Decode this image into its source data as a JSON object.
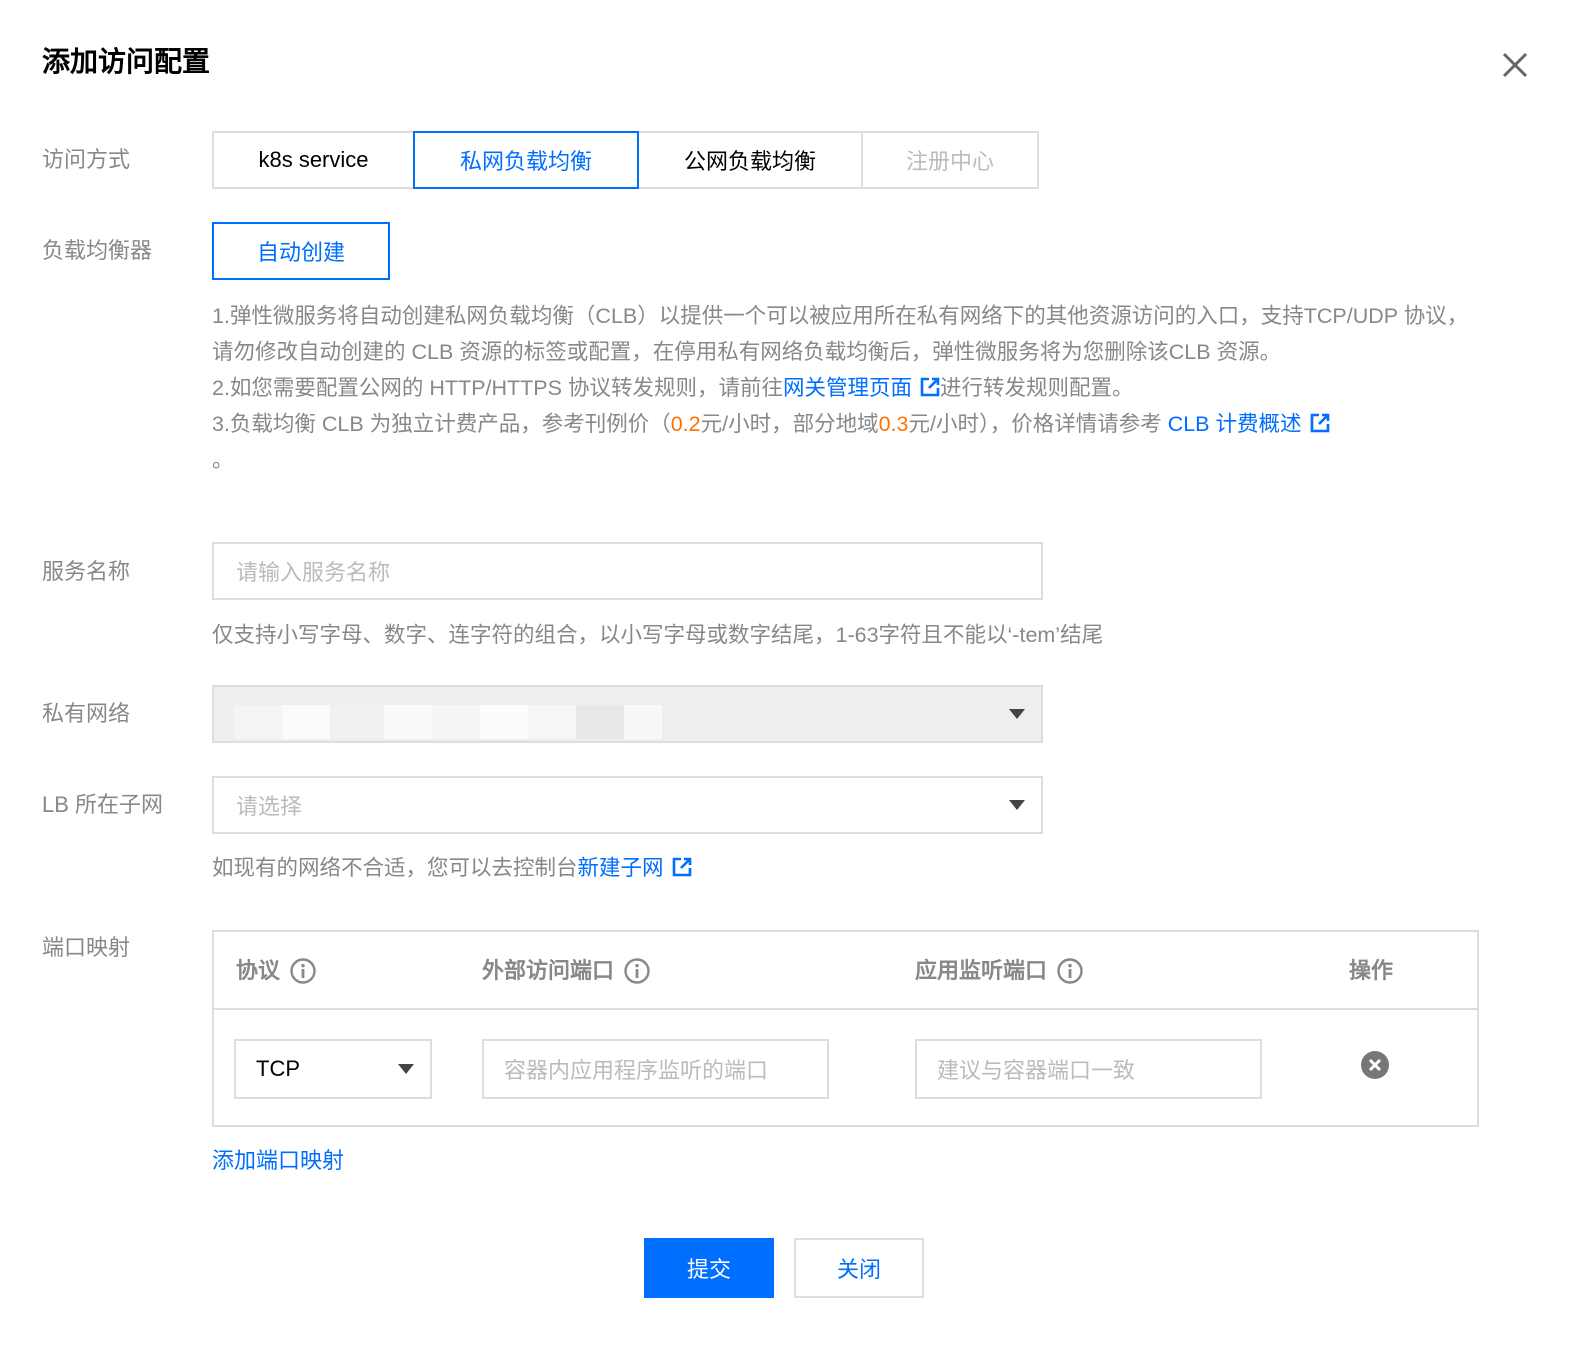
{
  "dialog": {
    "title": "添加访问配置"
  },
  "access_mode": {
    "label": "访问方式",
    "options": [
      "k8s service",
      "私网负载均衡",
      "公网负载均衡",
      "注册中心"
    ],
    "selected": "私网负载均衡",
    "disabled": [
      "注册中心"
    ]
  },
  "load_balancer": {
    "label": "负载均衡器",
    "button": "自动创建"
  },
  "notes": {
    "line1": "1.弹性微服务将自动创建私网负载均衡（CLB）以提供一个可以被应用所在私有网络下的其他资源访问的入口，支持TCP/UDP 协议，请勿修改自动创建的 CLB 资源的标签或配置，在停用私有网络负载均衡后，弹性微服务将为您删除该CLB 资源。",
    "line2_prefix": "2.如您需要配置公网的 HTTP/HTTPS 协议转发规则，请前往",
    "line2_link": "网关管理页面",
    "line2_suffix": "进行转发规则配置。",
    "line3_prefix": "3.负载均衡 CLB 为独立计费产品，参考刊例价（",
    "line3_price1": "0.2",
    "line3_mid": "元/小时，部分地域",
    "line3_price2": "0.3",
    "line3_suffix": "元/小时），价格详情请参考 ",
    "line3_link": "CLB 计费概述",
    "line3_end": "。"
  },
  "service_name": {
    "label": "服务名称",
    "placeholder": "请输入服务名称",
    "hint": "仅支持小写字母、数字、连字符的组合，以小写字母或数字结尾，1-63字符且不能以‘-tem’结尾"
  },
  "vpc": {
    "label": "私有网络"
  },
  "subnet": {
    "label": "LB 所在子网",
    "placeholder": "请选择",
    "hint_prefix": "如现有的网络不合适，您可以去控制台",
    "hint_link": "新建子网"
  },
  "port_mapping": {
    "label": "端口映射",
    "columns": [
      "协议",
      "外部访问端口",
      "应用监听端口",
      "操作"
    ],
    "rows": [
      {
        "protocol": "TCP",
        "external_port_placeholder": "容器内应用程序监听的端口",
        "app_port_placeholder": "建议与容器端口一致"
      }
    ],
    "add_link": "添加端口映射"
  },
  "footer": {
    "submit": "提交",
    "close": "关闭"
  },
  "colors": {
    "primary": "#006eff",
    "price": "#ff7200",
    "label": "#888888",
    "border": "#dddddd"
  },
  "icons": {
    "close": "close-icon",
    "external_link": "external-link-icon",
    "info": "info-icon",
    "delete": "delete-circle-icon",
    "dropdown": "chevron-down-icon"
  }
}
